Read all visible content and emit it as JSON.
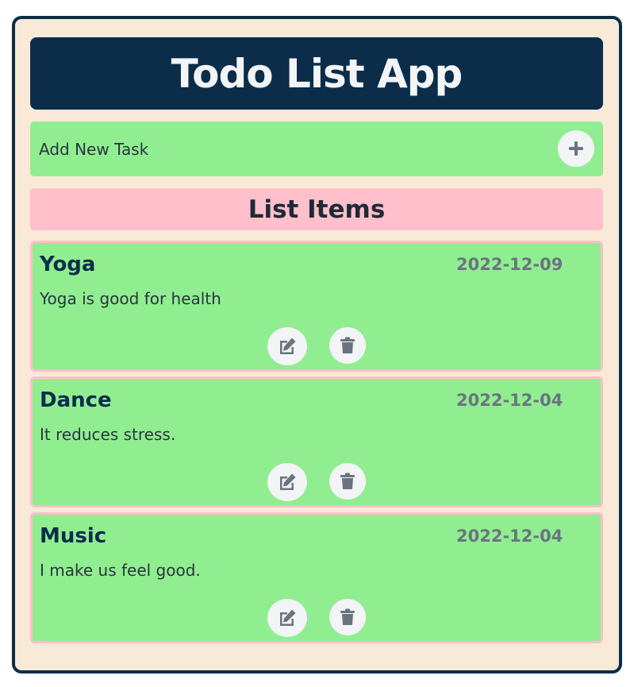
{
  "app": {
    "title": "Todo List App"
  },
  "add_task": {
    "label": "Add New Task",
    "button_icon": "plus-icon"
  },
  "list": {
    "header": "List Items",
    "items": [
      {
        "title": "Yoga",
        "date": "2022-12-09",
        "description": "Yoga is good for health",
        "edit_icon": "edit-icon",
        "delete_icon": "trash-icon"
      },
      {
        "title": "Dance",
        "date": "2022-12-04",
        "description": "It reduces stress.",
        "edit_icon": "edit-icon",
        "delete_icon": "trash-icon"
      },
      {
        "title": "Music",
        "date": "2022-12-04",
        "description": "I make us feel good.",
        "edit_icon": "edit-icon",
        "delete_icon": "trash-icon"
      }
    ]
  },
  "colors": {
    "frame_border": "#0b2d4a",
    "frame_bg": "#f9e9d7",
    "header_bg": "#0b2d4a",
    "card_green": "#90ee90",
    "accent_pink": "#ffbfcb",
    "button_bg": "#f3f4f6",
    "icon_gray": "#6b7380"
  }
}
